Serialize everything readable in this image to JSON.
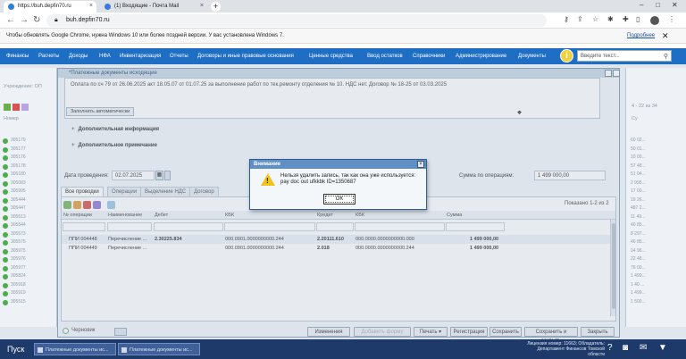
{
  "browser": {
    "tabs": [
      {
        "label": "https://buh.depfin70.ru",
        "active": true
      },
      {
        "label": "(1) Входящие - Почта Mail",
        "active": false
      }
    ],
    "new_tab": "+",
    "url": "buh.depfin70.ru",
    "window_controls": [
      "–",
      "□",
      "✕"
    ]
  },
  "infobar": {
    "text": "Чтобы обновлять Google Chrome, нужна Windows 10 или более поздней версии. У вас установлена Windows 7.",
    "link": "Подробнее",
    "close": "✕"
  },
  "menu": {
    "items": [
      "Финансы",
      "Расчеты",
      "Доходы",
      "НФА",
      "Инвентаризация",
      "Отчеты",
      "Договоры и иные правовые основания",
      "Ценные средства",
      "Ввод остатков",
      "Справочники",
      "Администрирование",
      "Документы"
    ],
    "info_icon": "i",
    "search_placeholder": "Введите текст..."
  },
  "left_panel": {
    "header": "Учреждение: ОП",
    "col": "Номер",
    "rows": [
      "305179",
      "305177",
      "305176",
      "305178",
      "305180",
      "305083",
      "305995",
      "305444",
      "305447",
      "305513",
      "305544",
      "305573",
      "305575",
      "305975",
      "305976",
      "305977",
      "305824",
      "305918",
      "305919",
      "305515"
    ]
  },
  "right_panel": {
    "pager": "4 - 22 из 34",
    "col": "Су",
    "rows": [
      "60 02...",
      "50 01...",
      "10 00...",
      "57 48...",
      "51 04...",
      "2 995...",
      "17 00...",
      "19 26...",
      "487 2...",
      "11 49...",
      "40 85...",
      "8 297...",
      "46 85...",
      "14 96...",
      "22 48...",
      "76 00...",
      "1 499...",
      "1 40 ...",
      "1 499...",
      "1 500..."
    ]
  },
  "doc": {
    "title": "*Платежные документы исходящие",
    "notes": "Оплата по сч 79 от 26.06.2025 акт 18.05.07 от 01.07.25 за выполнение работ по тек.ремонту отделения № 10. НДС нет. Договор № 18-25 от 03.03.2025",
    "fill_button": "Заполнить автоматически",
    "section_extra": "Дополнительная информация",
    "section_note": "Дополнительное примечание",
    "date_label": "Дата проведения:",
    "date_value": "02.07.2025",
    "sum_label": "Сумма по операциям:",
    "sum_value": "1 499 000,00",
    "tabs": [
      "Все проводки",
      "Операции",
      "Выделение НДС",
      "Договор"
    ],
    "shown": "Показано 1-2 из 2",
    "columns": [
      "№ операции",
      "Наименование",
      "Дебет",
      "КБК",
      "Кредит",
      "КБК",
      "Сумма"
    ],
    "rows": [
      {
        "num": "ППИ 004448",
        "name": "Перечисление ...",
        "debit": "2.30225.834",
        "kbk1": "000.0901.0000000000.244",
        "credit": "2.20111.610",
        "kbk2": "000.0000.0000000000.000",
        "sum": "1 499 000,00"
      },
      {
        "num": "ППИ 004449",
        "name": "Перечисление ...",
        "debit": "",
        "kbk1": "000.0901.0000000000.244",
        "credit": "2.018",
        "kbk2": "000.0000.0000000000.244",
        "sum": "1 499 000,00"
      }
    ]
  },
  "actions": {
    "draft": "Черновик",
    "change": "Изменения",
    "add_form": "Добавить форму",
    "print": "Печать ▾",
    "register": "Регистрация",
    "save": "Сохранить",
    "save_close": "Сохранить и закрыть",
    "close": "Закрыть"
  },
  "alert": {
    "title": "Внимание",
    "message": "Нельзя удалить запись, так как она уже используется: pay doc out ufkkbk ID=1350687",
    "ok": "OK"
  },
  "taskbar": {
    "start": "Пуск",
    "tasks": [
      "Платежные документы ис...",
      "Платежные документы ис..."
    ],
    "license": "Лицензия номер: 11663; Обладатель: Департамент Финансов Томской области"
  }
}
